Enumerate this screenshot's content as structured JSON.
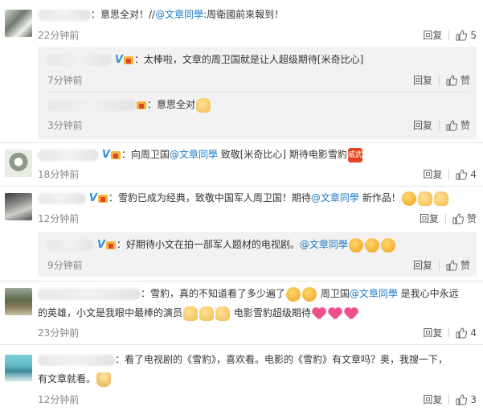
{
  "comments": [
    {
      "text_before": "：意思全对！//",
      "mention": "@文章同學",
      "text_after": ":周衛國前來報到！",
      "time": "22分钟前",
      "reply": "回复",
      "likes": "5",
      "replies": [
        {
          "badge_v": "V",
          "text": "：太棒啦，文章的周卫国就是让人超级期待[米奇比心]",
          "time": "7分钟前",
          "reply": "回复",
          "likes": "赞"
        },
        {
          "text": "：意思全对",
          "time": "3分钟前",
          "reply": "回复",
          "likes": "赞"
        }
      ]
    },
    {
      "badge_v": "V",
      "text_before": "：向周卫国",
      "mention": "@文章同學",
      "text_after": " 致敬[米奇比心] 期待电影雪豹",
      "emoji_label": "威武",
      "time": "18分钟前",
      "reply": "回复",
      "likes": "4"
    },
    {
      "badge_v": "V",
      "text_before": "：雪豹已成为经典，致敬中国军人周卫国！期待",
      "mention": "@文章同學",
      "text_after": " 新作品！",
      "time": "12分钟前",
      "reply": "回复",
      "likes": "赞",
      "replies": [
        {
          "badge_v": "V",
          "text_before": "：好期待小文在拍一部军人题材的电视剧。",
          "mention": "@文章同學",
          "time": "9分钟前",
          "reply": "回复",
          "likes": "赞"
        }
      ]
    },
    {
      "text_before": "：雪豹，真的不知道看了多少遍了",
      "text_mid": " 周卫国",
      "mention": "@文章同學",
      "text_after": " 是我心中永远",
      "line2_before": "的英雄，小文是我眼中最棒的演员",
      "line2_after": " 电影雪豹超级期待",
      "time": "23分钟前",
      "reply": "回复",
      "likes": "4"
    },
    {
      "text": "：看了电视剧的《雪豹》，喜欢看。电影的《雪豹》有文章吗？奥，我搜一下，",
      "line2": "有文章就看。",
      "time": "12分钟前",
      "reply": "回复",
      "likes": "3"
    }
  ]
}
